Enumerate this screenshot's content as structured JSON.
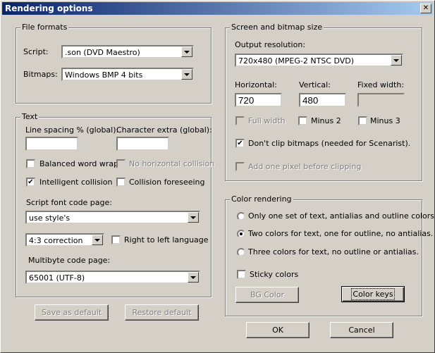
{
  "window": {
    "title": "Rendering options",
    "close_glyph": "✕"
  },
  "file_formats": {
    "legend": "File formats",
    "script_label": "Script:",
    "script_value": ".son (DVD Maestro)",
    "bitmaps_label": "Bitmaps:",
    "bitmaps_value": "Windows BMP 4 bits"
  },
  "text": {
    "legend": "Text",
    "line_spacing_label": "Line spacing % (global):",
    "line_spacing_value": "",
    "char_extra_label": "Character extra (global):",
    "char_extra_value": "",
    "balanced_wrap": {
      "label": "Balanced word wrap",
      "checked": false
    },
    "no_horizontal_collision": {
      "label": "No horizontal collision",
      "checked": false,
      "disabled": true
    },
    "intelligent_collision": {
      "label": "Intelligent collision",
      "checked": true
    },
    "collision_foreseeing": {
      "label": "Collision foreseeing",
      "checked": false
    },
    "script_font_code_page_label": "Script font code page:",
    "script_font_code_page_value": "use style's",
    "correction_value": "4:3 correction",
    "rtl": {
      "label": "Right to left language",
      "checked": false
    },
    "multibyte_label": "Multibyte code page:",
    "multibyte_value": "65001 (UTF-8)"
  },
  "bottom_left_buttons": {
    "save_default": "Save as default",
    "restore_default": "Restore default"
  },
  "screen": {
    "legend": "Screen and bitmap size",
    "output_resolution_label": "Output resolution:",
    "output_resolution_value": "720x480 (MPEG-2 NTSC DVD)",
    "horizontal_label": "Horizontal:",
    "horizontal_value": "720",
    "vertical_label": "Vertical:",
    "vertical_value": "480",
    "fixed_width_label": "Fixed width:",
    "fixed_width_value": "",
    "full_width": {
      "label": "Full width",
      "checked": false,
      "disabled": true
    },
    "minus2": {
      "label": "Minus 2",
      "checked": false
    },
    "minus3": {
      "label": "Minus 3",
      "checked": false
    },
    "dont_clip": {
      "label": "Don't clip bitmaps (needed for Scenarist).",
      "checked": true
    },
    "add_pixel": {
      "label": "Add one pixel before clipping",
      "checked": false,
      "disabled": true
    }
  },
  "color": {
    "legend": "Color rendering",
    "radio1": {
      "label": "Only one set of text, antialias and outline colors.",
      "selected": false
    },
    "radio2": {
      "label": "Two colors for text, one for outline, no antialias.",
      "selected": true
    },
    "radio3": {
      "label": "Three colors for text, no outline or antialias.",
      "selected": false
    },
    "sticky": {
      "label": "Sticky colors",
      "checked": false
    },
    "bg_color": "BG Color",
    "color_keys": "Color keys"
  },
  "dialog_buttons": {
    "ok": "OK",
    "cancel": "Cancel"
  }
}
